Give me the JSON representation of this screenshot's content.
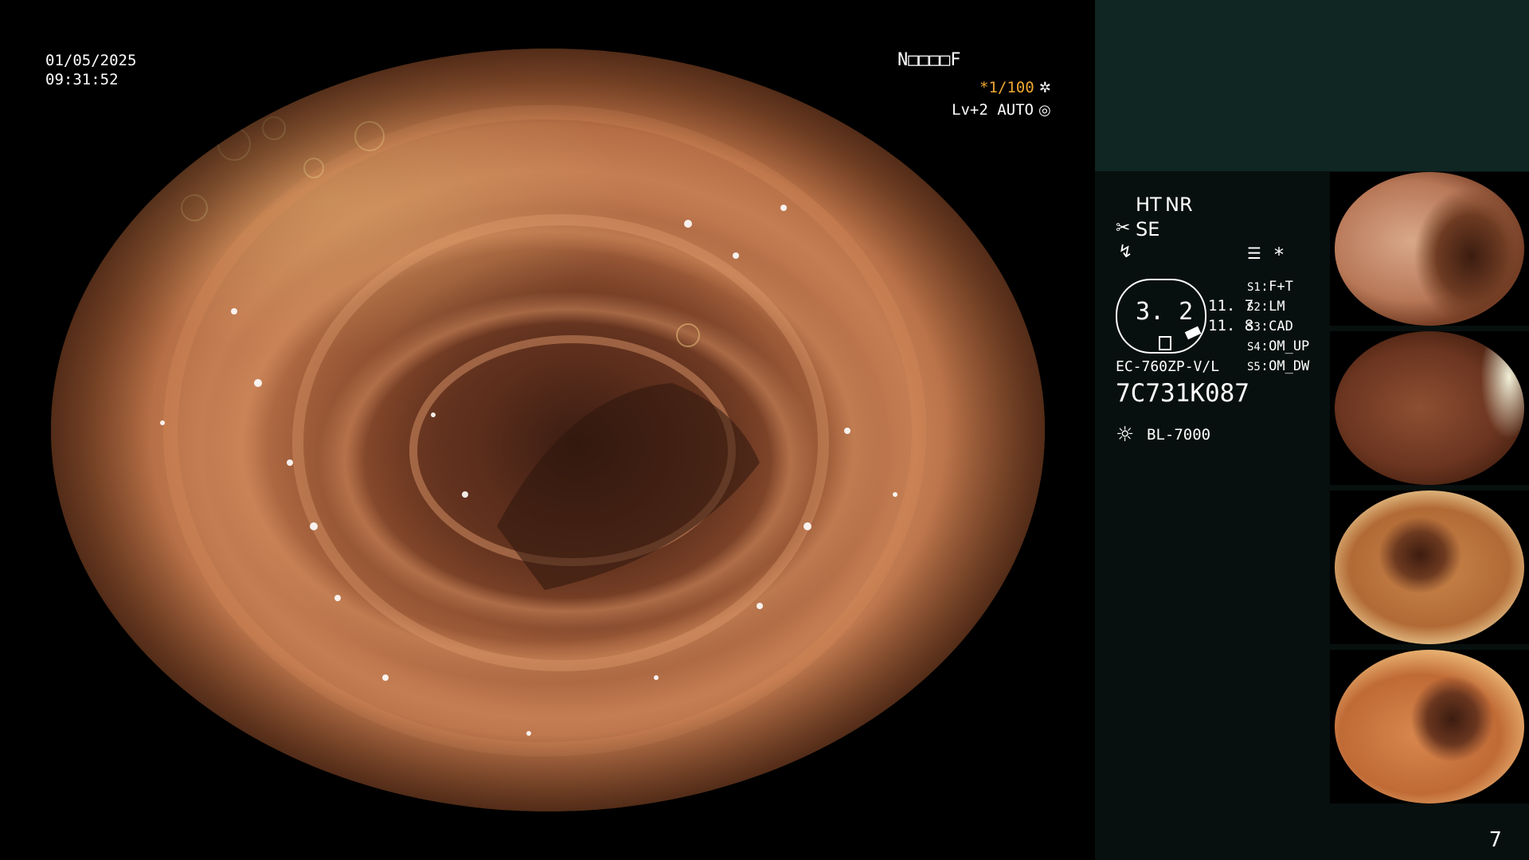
{
  "overlay": {
    "date": "01/05/2025",
    "time": "09:31:52",
    "patient_id": "N□□□□F",
    "shutter": "*1/100",
    "level": "Lv+2 AUTO"
  },
  "side": {
    "ht": "HT",
    "nr": "NR",
    "se": "SE",
    "star": "*",
    "gauge_value": "3. 2",
    "readout1": "11. 7",
    "readout2": "11. 8",
    "scope_model": "EC-760ZP-V/L",
    "serial": "7C731K087",
    "light_source": "BL-7000",
    "presets": [
      {
        "key": "S1",
        "value": "F+T"
      },
      {
        "key": "S2",
        "value": "LM"
      },
      {
        "key": "S3",
        "value": "CAD"
      },
      {
        "key": "S4",
        "value": "OM_UP"
      },
      {
        "key": "S5",
        "value": "OM_DW"
      }
    ],
    "page_number": "7"
  },
  "icons": {
    "shutter": "shutter-icon",
    "level": "iris-icon",
    "se": "scissors-icon",
    "light": "sun-icon",
    "menu": "document-icon"
  },
  "colors": {
    "accent_orange": "#f0a830",
    "panel_top": "#0f2623",
    "panel_bottom": "#07100e"
  },
  "thumbnails": [
    {
      "label": "thumbnail-1"
    },
    {
      "label": "thumbnail-2"
    },
    {
      "label": "thumbnail-3"
    },
    {
      "label": "thumbnail-4"
    }
  ]
}
